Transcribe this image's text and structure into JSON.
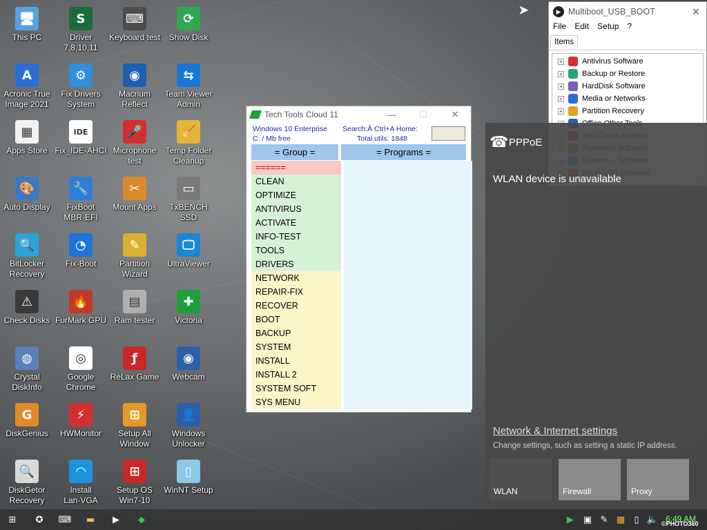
{
  "desktop": {
    "icons": [
      {
        "label": "This PC",
        "glyph": "🖥",
        "bg": "#5aa0e0"
      },
      {
        "label": "Driver\n7,8,10,11",
        "glyph": "S",
        "bg": "#1d6b3a"
      },
      {
        "label": "Keyboard test",
        "glyph": "⌨",
        "bg": "#4c4c4c"
      },
      {
        "label": "Show Disk",
        "glyph": "⟳",
        "bg": "#2fa84f"
      },
      {
        "label": "Acronic True\nImage 2021",
        "glyph": "A",
        "bg": "#2a6ed3"
      },
      {
        "label": "Fix Drivers\nSystem",
        "glyph": "⚙",
        "bg": "#2f8fdc"
      },
      {
        "label": "Macrium\nReflect",
        "glyph": "◉",
        "bg": "#1d5fb0"
      },
      {
        "label": "Team Viewer\nAdmin",
        "glyph": "⇆",
        "bg": "#1877d6"
      },
      {
        "label": "Apps Store",
        "glyph": "▦",
        "bg": "#f2f2f2"
      },
      {
        "label": "Fix_IDE-AHCI",
        "glyph": "IDE",
        "bg": "#ffffff"
      },
      {
        "label": "Microphone\ntest",
        "glyph": "🎤",
        "bg": "#d32f2f"
      },
      {
        "label": "Temp Folder\nCleanup",
        "glyph": "🧹",
        "bg": "#e6b43a"
      },
      {
        "label": "Auto Display",
        "glyph": "🎨",
        "bg": "#3a78c8"
      },
      {
        "label": "FixBoot\nMBR-EFI",
        "glyph": "🔧",
        "bg": "#2f7fd8"
      },
      {
        "label": "Mount Apps",
        "glyph": "✂",
        "bg": "#d98a2b"
      },
      {
        "label": "TxBENCH SSD",
        "glyph": "▭",
        "bg": "#7a7a7a"
      },
      {
        "label": "BitLocker\nRecovery",
        "glyph": "🔍",
        "bg": "#2aa3d9"
      },
      {
        "label": "Fix-Boot",
        "glyph": "◔",
        "bg": "#1f73d8"
      },
      {
        "label": "Partition\nWizard",
        "glyph": "✎",
        "bg": "#d9b02f"
      },
      {
        "label": "UltraViewer",
        "glyph": "🖵",
        "bg": "#1b88d6"
      },
      {
        "label": "Check Disks",
        "glyph": "⚠",
        "bg": "#3a3a3a"
      },
      {
        "label": "FurMark GPU",
        "glyph": "🔥",
        "bg": "#c0392b"
      },
      {
        "label": "Ram tester",
        "glyph": "▤",
        "bg": "#b0b0b0"
      },
      {
        "label": "Victoria",
        "glyph": "✚",
        "bg": "#1f9e3a"
      },
      {
        "label": "Crystal\nDiskInfo",
        "glyph": "◍",
        "bg": "#5b7fb8"
      },
      {
        "label": "Google\nChrome",
        "glyph": "◎",
        "bg": "#ffffff"
      },
      {
        "label": "ReLax Game",
        "glyph": "ƒ",
        "bg": "#c62828"
      },
      {
        "label": "Webcam",
        "glyph": "◉",
        "bg": "#2d5fa8"
      },
      {
        "label": "DiskGenius",
        "glyph": "G",
        "bg": "#e08a2a"
      },
      {
        "label": "HWMonitor",
        "glyph": "⚡",
        "bg": "#d32f2f"
      },
      {
        "label": "Setup All\nWindow",
        "glyph": "⊞",
        "bg": "#e39a2a"
      },
      {
        "label": "Windows\nUnlocker",
        "glyph": "👤",
        "bg": "#2a5fa8"
      },
      {
        "label": "DiskGetor\nRecovery",
        "glyph": "🔍",
        "bg": "#d9d9d9"
      },
      {
        "label": "Install\nLan-VGA",
        "glyph": "◠",
        "bg": "#1e90e0"
      },
      {
        "label": "Setup OS\nWin7-10",
        "glyph": "⊞",
        "bg": "#c62828"
      },
      {
        "label": "WinNT Setup",
        "glyph": "▯",
        "bg": "#8ec9e8"
      }
    ]
  },
  "techtools": {
    "title": "Tech Tools Cloud 11",
    "minimize": "—",
    "maximize": "☐",
    "close": "✕",
    "os": "Windows 10 Enterprise",
    "drive": "C:  /  Mb  free",
    "search": "Search:Â Ctrl+A Home:",
    "total": "Total utils:  1848",
    "group_header": "= Group =",
    "programs_header": "= Programs  =",
    "groups": [
      {
        "label": "======",
        "bg": "#f8c9c4",
        "color": "#c00000"
      },
      {
        "label": "CLEAN",
        "bg": "#d6f2d6",
        "color": "#000"
      },
      {
        "label": "OPTIMIZE",
        "bg": "#d6f2d6",
        "color": "#000"
      },
      {
        "label": "ANTIVIRUS",
        "bg": "#d6f2d6",
        "color": "#000"
      },
      {
        "label": "ACTIVATE",
        "bg": "#d6f2d6",
        "color": "#000"
      },
      {
        "label": "INFO-TEST",
        "bg": "#d6f2d6",
        "color": "#000"
      },
      {
        "label": "TOOLS",
        "bg": "#d6f2d6",
        "color": "#000"
      },
      {
        "label": "DRIVERS",
        "bg": "#d6f2d6",
        "color": "#000"
      },
      {
        "label": "NETWORK",
        "bg": "#fbf5c8",
        "color": "#000"
      },
      {
        "label": "REPAIR-FIX",
        "bg": "#fbf5c8",
        "color": "#000"
      },
      {
        "label": "RECOVER",
        "bg": "#fbf5c8",
        "color": "#000"
      },
      {
        "label": "BOOT",
        "bg": "#fbf5c8",
        "color": "#000"
      },
      {
        "label": "BACKUP",
        "bg": "#fbf5c8",
        "color": "#000"
      },
      {
        "label": "SYSTEM",
        "bg": "#fbf5c8",
        "color": "#000"
      },
      {
        "label": "INSTALL",
        "bg": "#fbf5c8",
        "color": "#000"
      },
      {
        "label": "INSTALL 2",
        "bg": "#fbf5c8",
        "color": "#000"
      },
      {
        "label": "SYSTEM SOFT",
        "bg": "#fbf5c8",
        "color": "#000"
      },
      {
        "label": "SYS MENU",
        "bg": "#fbf5c8",
        "color": "#000"
      }
    ]
  },
  "multiboot": {
    "title": "Multiboot_USB_BOOT",
    "close": "✕",
    "menu": [
      "File",
      "Edit",
      "Setup",
      "?"
    ],
    "tab": "Items",
    "items": [
      {
        "label": "Antivirus Software",
        "color": "#d32f2f"
      },
      {
        "label": "Backup or Restore",
        "color": "#2aa37a"
      },
      {
        "label": "HardDisk Software",
        "color": "#7a5fb8"
      },
      {
        "label": "Media or Networks",
        "color": "#2a6ed3"
      },
      {
        "label": "Partition Recovery",
        "color": "#e0a020"
      },
      {
        "label": "Office Other Tools",
        "color": "#2a5fb8"
      },
      {
        "label": "Test Check Hardisk",
        "color": "#c62828"
      },
      {
        "label": "Password Software",
        "color": "#b0702a"
      },
      {
        "label": "Systems - Software",
        "color": "#3a8fd8"
      },
      {
        "label": "DriverUSB Software",
        "color": "#d32f2f"
      }
    ]
  },
  "network": {
    "connection": "PPPoE",
    "wlan_message": "WLAN device is unavailable",
    "settings_link": "Network & Internet settings",
    "settings_desc": "Change settings, such as setting a static IP address.",
    "tiles": [
      "WLAN",
      "Firewall",
      "Proxy"
    ]
  },
  "taskbar": {
    "clock": "6:49 AM",
    "watermark": "©PHOTO360"
  }
}
